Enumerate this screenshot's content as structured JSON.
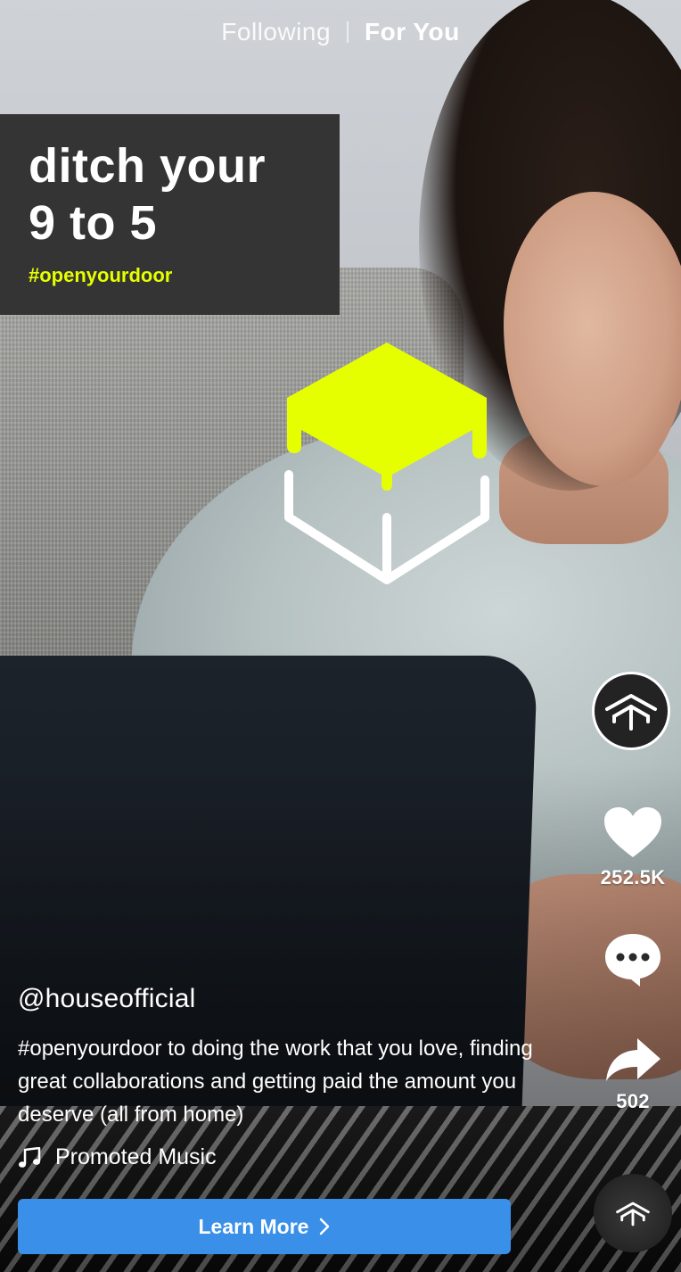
{
  "top_tabs": {
    "following": "Following",
    "for_you": "For You"
  },
  "headline": {
    "text": "ditch your\n9 to 5",
    "hashtag": "#openyourdoor"
  },
  "logo": {
    "icon": "house-cube-logo-icon",
    "top_color": "#e6ff00",
    "bottom_color": "#ffffff"
  },
  "actions": {
    "profile_icon": "house-brand-avatar-icon",
    "like_icon": "heart-icon",
    "likes": "252.5K",
    "comment_icon": "comment-bubble-icon",
    "share_icon": "share-arrow-icon",
    "shares": "502",
    "music_disc_icon": "music-disc-icon"
  },
  "post": {
    "username": "@houseofficial",
    "caption": "#openyourdoor to doing the work that you love, finding great collaborations and getting paid the amount you deserve (all from home)",
    "music": "Promoted Music"
  },
  "cta": {
    "label": "Learn More",
    "color": "#3a8fe8"
  }
}
